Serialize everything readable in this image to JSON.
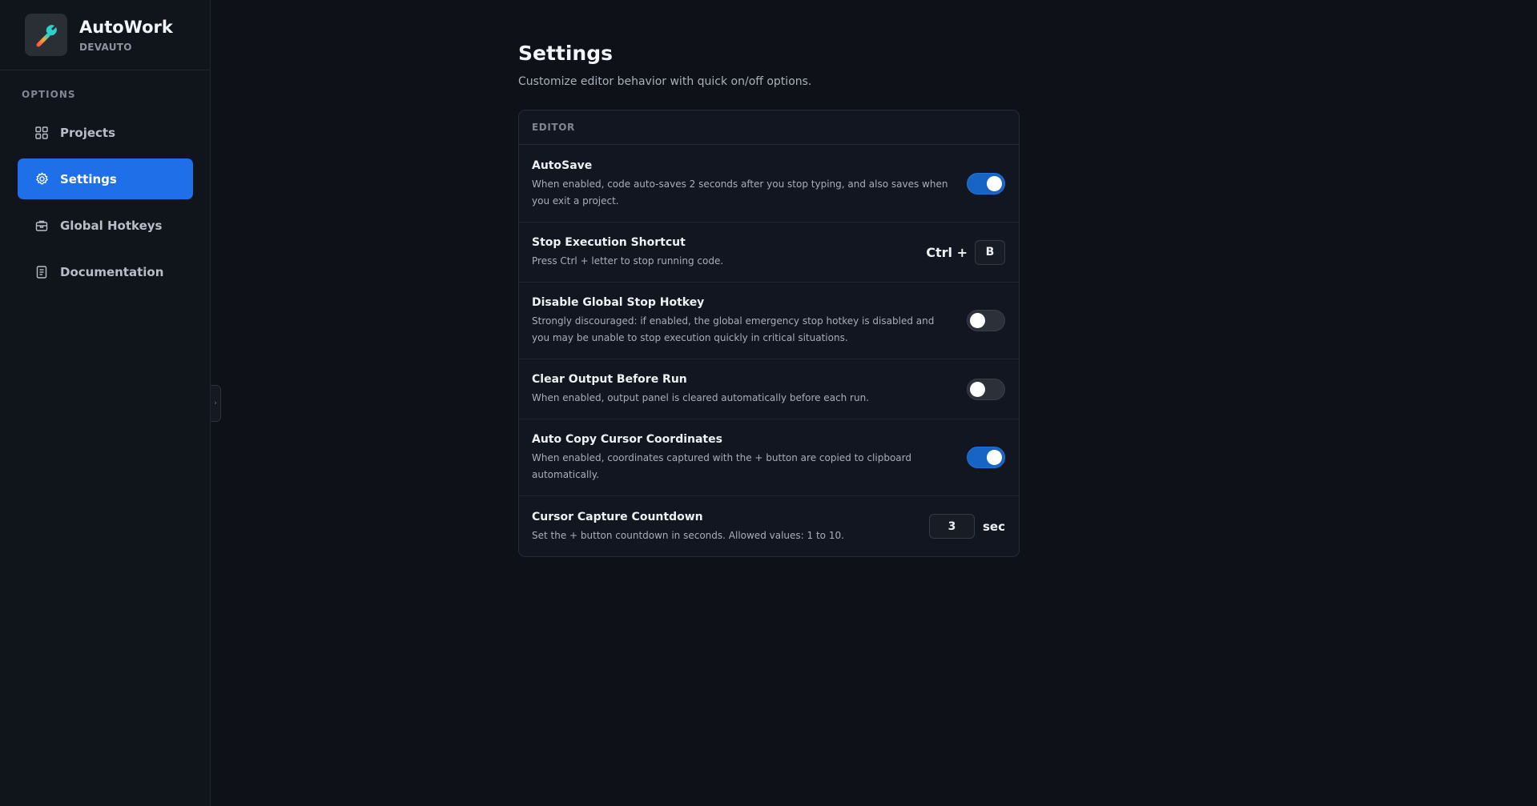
{
  "brand": {
    "title": "AutoWork",
    "subtitle": "DEVAUTO",
    "logo_icon": "wrench-icon"
  },
  "sidebar": {
    "section_label": "OPTIONS",
    "items": [
      {
        "label": "Projects",
        "icon": "grid-icon",
        "active": false
      },
      {
        "label": "Settings",
        "icon": "gear-icon",
        "active": true
      },
      {
        "label": "Global Hotkeys",
        "icon": "briefcase-icon",
        "active": false
      },
      {
        "label": "Documentation",
        "icon": "document-icon",
        "active": false
      }
    ],
    "collapse_glyph": "›"
  },
  "page": {
    "title": "Settings",
    "subtitle": "Customize editor behavior with quick on/off options."
  },
  "card": {
    "header": "EDITOR",
    "rows": [
      {
        "title": "AutoSave",
        "desc": "When enabled, code auto-saves 2 seconds after you stop typing, and also saves when you exit a project.",
        "control": "toggle",
        "on": true
      },
      {
        "title": "Stop Execution Shortcut",
        "desc": "Press Ctrl + letter to stop running code.",
        "control": "shortcut",
        "prefix": "Ctrl +",
        "key": "B"
      },
      {
        "title": "Disable Global Stop Hotkey",
        "desc": "Strongly discouraged: if enabled, the global emergency stop hotkey is disabled and you may be unable to stop execution quickly in critical situations.",
        "control": "toggle",
        "on": false
      },
      {
        "title": "Clear Output Before Run",
        "desc": "When enabled, output panel is cleared automatically before each run.",
        "control": "toggle",
        "on": false
      },
      {
        "title": "Auto Copy Cursor Coordinates",
        "desc": "When enabled, coordinates captured with the + button are copied to clipboard automatically.",
        "control": "toggle",
        "on": true
      },
      {
        "title": "Cursor Capture Countdown",
        "desc": "Set the + button countdown in seconds. Allowed values: 1 to 10.",
        "control": "number",
        "value": "3",
        "unit": "sec"
      }
    ]
  },
  "colors": {
    "accent": "#1f6fe8",
    "toggle_on": "#1764c4",
    "background": "#0e1118",
    "sidebar": "#10141b"
  }
}
